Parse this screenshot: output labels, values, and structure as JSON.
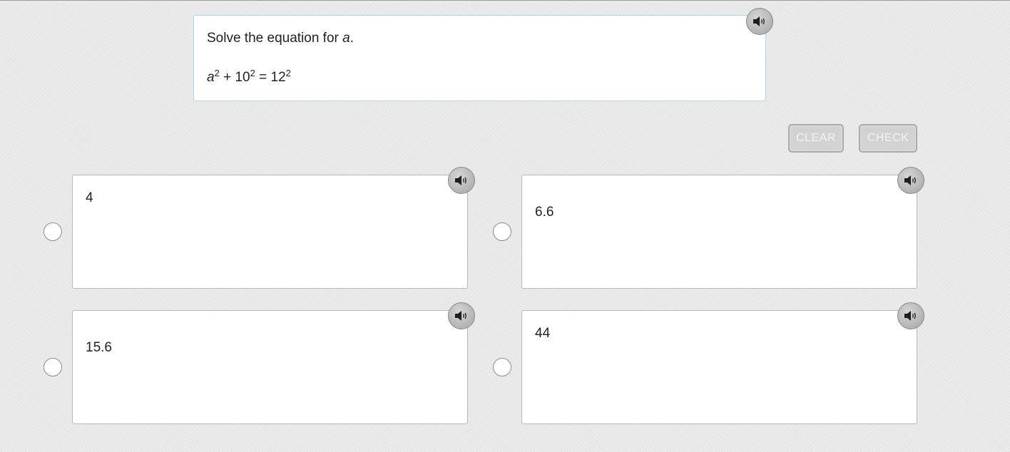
{
  "question": {
    "prompt_text": "Solve the equation for ",
    "prompt_variable": "a",
    "prompt_end": ".",
    "equation": {
      "var": "a",
      "exp1": "2",
      "plus": " + 10",
      "exp2": "2",
      "equals": " = 12",
      "exp3": "2"
    }
  },
  "buttons": {
    "clear_label": "CLEAR",
    "check_label": "CHECK"
  },
  "choices": [
    {
      "label": "4"
    },
    {
      "label": "6.6"
    },
    {
      "label": "15.6"
    },
    {
      "label": "44"
    }
  ],
  "icons": {
    "audio": "speaker-icon"
  },
  "colors": {
    "card_border_question": "#a9d9e8",
    "button_bg_disabled": "#d2d2d2"
  }
}
